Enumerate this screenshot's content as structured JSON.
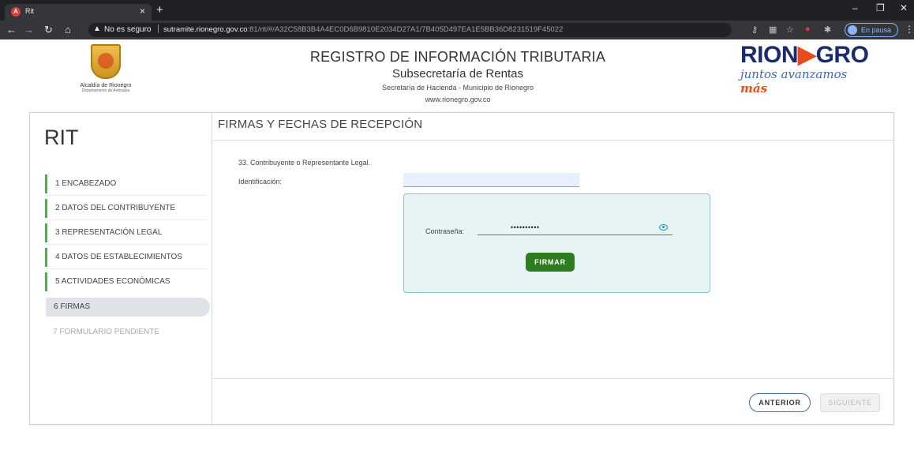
{
  "browser": {
    "tab_title": "Rit",
    "tab_favicon": "A",
    "not_secure": "No es seguro",
    "url_host": "sutramite.rionegro.gov.co",
    "url_rest": ":81/rit/#/A32C58B3B4A4EC0D6B9810E2034D27A1/7B405D497EA1E5BB36D8231519F45022",
    "profile_label": "En pausa"
  },
  "header": {
    "alcaldia_name": "Alcaldía de Rionegro",
    "alcaldia_dept": "Departamento de Antioquia",
    "title": "REGISTRO DE INFORMACIÓN TRIBUTARIA",
    "subtitle": "Subsecretaría de Rentas",
    "secretaria": "Secretaría de Hacienda - Municipio de Rionegro",
    "website": "www.rionegro.gov.co",
    "brand_part1": "RION",
    "brand_arrow": "▶",
    "brand_part2": "GRO",
    "slogan": "juntos avanzamos ",
    "slogan_mas": "más"
  },
  "sidebar": {
    "title": "RIT",
    "steps": [
      {
        "label": "1 ENCABEZADO",
        "state": "done"
      },
      {
        "label": "2 DATOS DEL CONTRIBUYENTE",
        "state": "done"
      },
      {
        "label": "3 REPRESENTACIÓN LEGAL",
        "state": "done"
      },
      {
        "label": "4 DATOS DE ESTABLECIMIENTOS",
        "state": "done"
      },
      {
        "label": "5 ACTIVIDADES ECONÓMICAS",
        "state": "done"
      },
      {
        "label": "6 FIRMAS",
        "state": "active"
      },
      {
        "label": "7  FORMULARIO PENDIENTE",
        "state": "pending"
      }
    ]
  },
  "main": {
    "section_title": "FIRMAS Y FECHAS DE RECEPCIÓN",
    "contribuyente_label": "33. Contribuyente o Representante Legal.",
    "identificacion_label": "Identificación:",
    "identificacion_value": "",
    "password_label": "Contraseña:",
    "password_value": "••••••••••",
    "sign_button": "FIRMAR",
    "prev_button": "ANTERIOR",
    "next_button": "SIGUIENTE"
  },
  "colors": {
    "step_done_bar": "#4caf50",
    "sign_button_bg": "#2e7d1e",
    "sign_box_bg": "#e7f4f6",
    "brand_navy": "#1a2b6d",
    "brand_orange": "#e84b1c"
  }
}
